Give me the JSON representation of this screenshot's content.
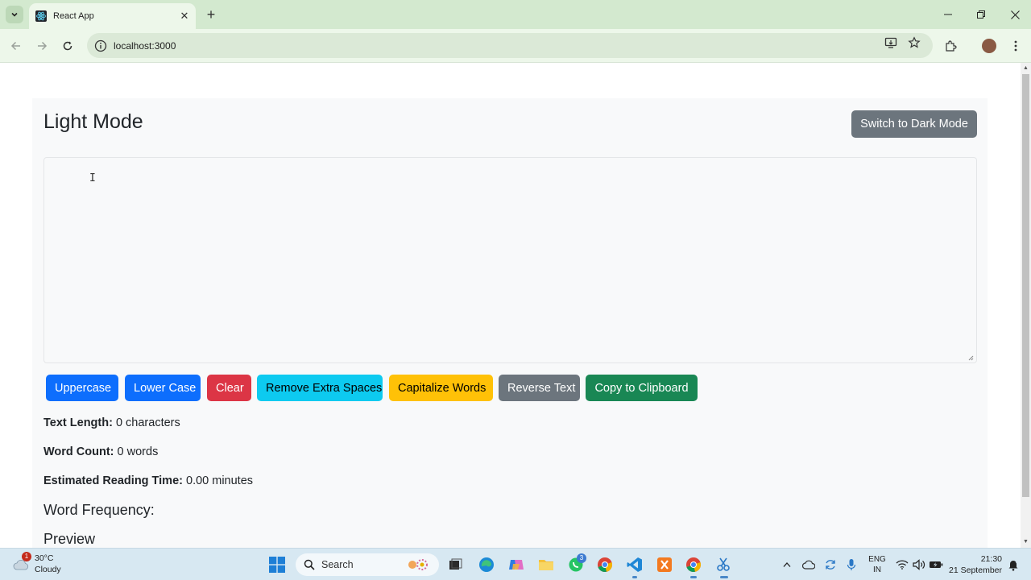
{
  "browser": {
    "tab_title": "React App",
    "url": "localhost:3000",
    "new_tab_glyph": "+",
    "close_glyph": "✕"
  },
  "page": {
    "title": "Light Mode",
    "mode_button": "Switch to Dark Mode",
    "textarea_value": "",
    "buttons": [
      {
        "label": "Uppercase",
        "style": "primary"
      },
      {
        "label": "Lower Case",
        "style": "primary"
      },
      {
        "label": "Clear",
        "style": "danger"
      },
      {
        "label": "Remove Extra Spaces",
        "style": "info"
      },
      {
        "label": "Capitalize Words",
        "style": "warning"
      },
      {
        "label": "Reverse Text",
        "style": "secondary"
      },
      {
        "label": "Copy to Clipboard",
        "style": "success"
      }
    ],
    "stats": {
      "text_length_label": "Text Length:",
      "text_length_value": "0 characters",
      "word_count_label": "Word Count:",
      "word_count_value": "0 words",
      "reading_time_label": "Estimated Reading Time:",
      "reading_time_value": "0.00 minutes"
    },
    "word_frequency_heading": "Word Frequency:",
    "preview_heading": "Preview"
  },
  "taskbar": {
    "weather_temp": "30°C",
    "weather_desc": "Cloudy",
    "weather_badge": "1",
    "search_placeholder": "Search",
    "whatsapp_badge": "3",
    "lang_line1": "ENG",
    "lang_line2": "IN",
    "time": "21:30",
    "date": "21 September"
  },
  "colors": {
    "primary": "#0d6efd",
    "danger": "#dc3545",
    "info": "#0dcaf0",
    "warning": "#ffc107",
    "secondary": "#6c757d",
    "success": "#198754"
  }
}
